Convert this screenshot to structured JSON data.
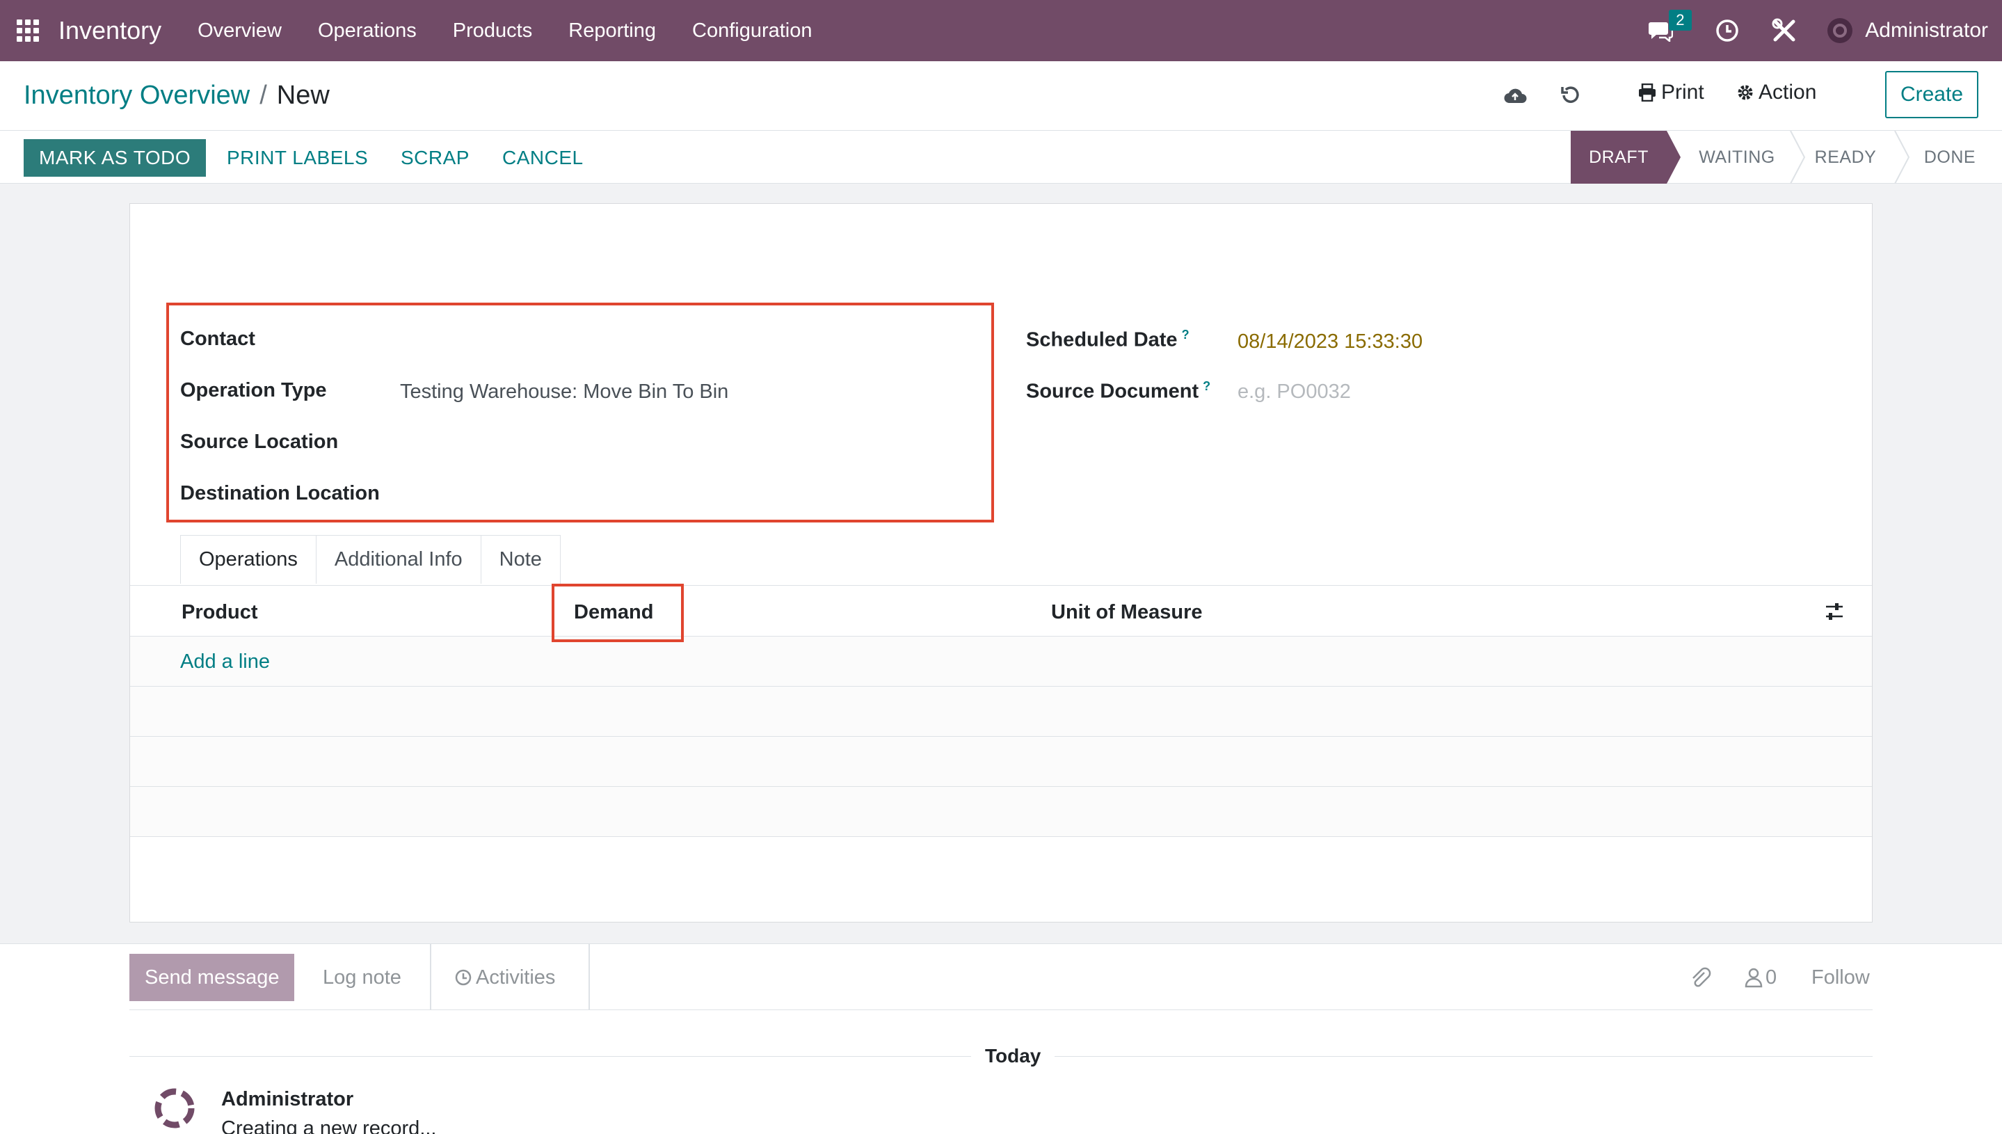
{
  "navbar": {
    "app_name": "Inventory",
    "menu": [
      "Overview",
      "Operations",
      "Products",
      "Reporting",
      "Configuration"
    ],
    "messages_count": "2",
    "user_name": "Administrator"
  },
  "control_panel": {
    "breadcrumb_parent": "Inventory Overview",
    "breadcrumb_separator": "/",
    "breadcrumb_current": "New",
    "print_label": "Print",
    "action_label": "Action",
    "create_label": "Create"
  },
  "statusbar": {
    "buttons": [
      "MARK AS TODO",
      "PRINT LABELS",
      "SCRAP",
      "CANCEL"
    ],
    "stages": [
      "DRAFT",
      "WAITING",
      "READY",
      "DONE"
    ],
    "active_stage": "DRAFT"
  },
  "form": {
    "left_fields": [
      {
        "label": "Contact",
        "value": ""
      },
      {
        "label": "Operation Type",
        "value": "Testing Warehouse: Move Bin To Bin"
      },
      {
        "label": "Source Location",
        "value": ""
      },
      {
        "label": "Destination Location",
        "value": ""
      }
    ],
    "scheduled_date_label": "Scheduled Date",
    "scheduled_date_value": "08/14/2023 15:33:30",
    "source_document_label": "Source Document",
    "source_document_placeholder": "e.g. PO0032",
    "help_mark": "?"
  },
  "tabs": [
    "Operations",
    "Additional Info",
    "Note"
  ],
  "table": {
    "columns": [
      "Product",
      "Demand",
      "Unit of Measure"
    ],
    "add_line": "Add a line"
  },
  "chatter": {
    "send_message": "Send message",
    "log_note": "Log note",
    "activities": "Activities",
    "followers_count": "0",
    "follow": "Follow",
    "date_separator": "Today",
    "message_author": "Administrator",
    "message_body": "Creating a new record..."
  },
  "colors": {
    "brand": "#714b67",
    "accent": "#017e84",
    "highlight": "#e0452f"
  }
}
